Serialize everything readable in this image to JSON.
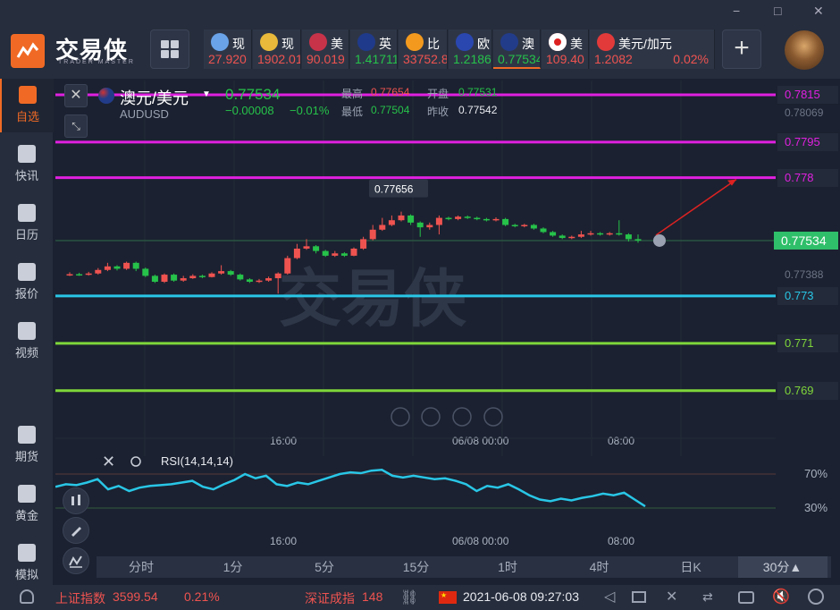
{
  "app": {
    "logo_text": "交易侠",
    "logo_sub": "TRADER MASTER",
    "window_controls": [
      "−",
      "□",
      "✕"
    ]
  },
  "colors": {
    "up": "#ef5350",
    "down": "#26c24a",
    "accent": "#f06a25",
    "magenta": "#e020e0",
    "cyan": "#29c6e6",
    "lime": "#7ed63a",
    "rsi": "#29c6e6"
  },
  "tickers": [
    {
      "name": "现",
      "price": "27.920",
      "icon": "silver-coins-icon",
      "color": "#ef5350"
    },
    {
      "name": "现",
      "price": "1902.01",
      "icon": "gold-coins-icon",
      "color": "#ef5350"
    },
    {
      "name": "美",
      "price": "90.019",
      "icon": "us-flag-icon",
      "color": "#ef5350"
    },
    {
      "name": "英",
      "price": "1.41711",
      "icon": "uk-flag-icon",
      "color": "#26c24a"
    },
    {
      "name": "比",
      "price": "33752.8",
      "icon": "bitcoin-icon",
      "color": "#ef5350"
    },
    {
      "name": "欧",
      "price": "1.21866",
      "icon": "eu-flag-icon",
      "color": "#26c24a"
    },
    {
      "name": "澳",
      "price": "0.77534",
      "icon": "au-flag-icon",
      "color": "#26c24a"
    },
    {
      "name": "美",
      "price": "109.40",
      "icon": "jp-flag-icon",
      "color": "#ef5350"
    },
    {
      "name": "美元/加元",
      "price": "1.2082",
      "change": "0.02%",
      "icon": "ca-flag-icon",
      "color": "#ef5350"
    }
  ],
  "sidebar": {
    "items": [
      {
        "label": "自选",
        "icon": "favorites-icon"
      },
      {
        "label": "快讯",
        "icon": "news-icon"
      },
      {
        "label": "日历",
        "icon": "calendar-icon"
      },
      {
        "label": "报价",
        "icon": "quotes-icon"
      },
      {
        "label": "视频",
        "icon": "video-icon"
      },
      {
        "label": "期货",
        "icon": "futures-icon"
      },
      {
        "label": "黄金",
        "icon": "gold-icon"
      },
      {
        "label": "模拟",
        "icon": "simulate-icon"
      }
    ]
  },
  "symbol": {
    "name": "澳元/美元",
    "code": "AUDUSD",
    "price": "0.77534",
    "change": "−0.00008",
    "change_pct": "−0.01%",
    "high_label": "最高",
    "high": "0.77654",
    "open_label": "开盘",
    "open": "0.77531",
    "low_label": "最低",
    "low": "0.77504",
    "prev_label": "昨收",
    "prev": "0.77542"
  },
  "chart_data": {
    "type": "candlestick",
    "title": "澳元/美元",
    "ylim": [
      0.7685,
      0.7818
    ],
    "hlines": [
      {
        "value": 0.7815,
        "label": "0.7815",
        "color": "#e020e0"
      },
      {
        "value": 0.7795,
        "label": "0.7795",
        "color": "#e020e0"
      },
      {
        "value": 0.778,
        "label": "0.778",
        "color": "#e020e0"
      },
      {
        "value": 0.773,
        "label": "0.773",
        "color": "#29c6e6"
      },
      {
        "value": 0.771,
        "label": "0.771",
        "color": "#7ed63a"
      },
      {
        "value": 0.769,
        "label": "0.769",
        "color": "#7ed63a"
      }
    ],
    "axis_labels": [
      "0.78069",
      "0.77388"
    ],
    "current_price_label": "0.77534",
    "high_marker": "0.77656",
    "x_ticks": [
      "16:00",
      "06/08 00:00",
      "08:00"
    ],
    "candles": [
      [
        0.77388,
        0.77392,
        0.774,
        0.77384
      ],
      [
        0.77392,
        0.7739,
        0.77398,
        0.77385
      ],
      [
        0.7739,
        0.77395,
        0.77402,
        0.77386
      ],
      [
        0.77395,
        0.7741,
        0.77418,
        0.7739
      ],
      [
        0.7741,
        0.77425,
        0.7744,
        0.77405
      ],
      [
        0.77425,
        0.77415,
        0.7743,
        0.77408
      ],
      [
        0.77415,
        0.7744,
        0.77445,
        0.7741
      ],
      [
        0.7744,
        0.77415,
        0.77445,
        0.77405
      ],
      [
        0.77415,
        0.77385,
        0.7742,
        0.7738
      ],
      [
        0.77385,
        0.7736,
        0.7739,
        0.77355
      ],
      [
        0.7736,
        0.7739,
        0.77395,
        0.77355
      ],
      [
        0.7739,
        0.77365,
        0.77395,
        0.7736
      ],
      [
        0.77365,
        0.77375,
        0.77385,
        0.7736
      ],
      [
        0.77375,
        0.77385,
        0.77392,
        0.77372
      ],
      [
        0.77385,
        0.7738,
        0.7739,
        0.77375
      ],
      [
        0.7738,
        0.77395,
        0.774,
        0.77378
      ],
      [
        0.77395,
        0.77405,
        0.7743,
        0.7739
      ],
      [
        0.77405,
        0.7739,
        0.7741,
        0.77385
      ],
      [
        0.7739,
        0.7737,
        0.77395,
        0.77365
      ],
      [
        0.7737,
        0.7736,
        0.77375,
        0.77355
      ],
      [
        0.7736,
        0.77365,
        0.77372,
        0.77355
      ],
      [
        0.77365,
        0.77375,
        0.77382,
        0.7736
      ],
      [
        0.77375,
        0.77395,
        0.774,
        0.7731
      ],
      [
        0.77395,
        0.7746,
        0.7747,
        0.7739
      ],
      [
        0.7746,
        0.775,
        0.7752,
        0.77455
      ],
      [
        0.775,
        0.7751,
        0.7754,
        0.77495
      ],
      [
        0.7751,
        0.7749,
        0.77515,
        0.7748
      ],
      [
        0.7749,
        0.7747,
        0.77495,
        0.77465
      ],
      [
        0.7747,
        0.7748,
        0.7749,
        0.77465
      ],
      [
        0.7748,
        0.7747,
        0.77485,
        0.77465
      ],
      [
        0.7747,
        0.775,
        0.77505,
        0.77468
      ],
      [
        0.775,
        0.7754,
        0.7755,
        0.77495
      ],
      [
        0.7754,
        0.7758,
        0.776,
        0.77535
      ],
      [
        0.7758,
        0.776,
        0.7763,
        0.77575
      ],
      [
        0.776,
        0.7762,
        0.7764,
        0.77595
      ],
      [
        0.7762,
        0.7764,
        0.77656,
        0.77615
      ],
      [
        0.7764,
        0.7761,
        0.77645,
        0.776
      ],
      [
        0.7761,
        0.7759,
        0.77615,
        0.7755
      ],
      [
        0.7759,
        0.776,
        0.7761,
        0.7758
      ],
      [
        0.776,
        0.7763,
        0.7764,
        0.7756
      ],
      [
        0.7763,
        0.77625,
        0.77635,
        0.7762
      ],
      [
        0.77625,
        0.77635,
        0.7764,
        0.7762
      ],
      [
        0.77635,
        0.7763,
        0.7764,
        0.77625
      ],
      [
        0.7763,
        0.77625,
        0.77635,
        0.7762
      ],
      [
        0.77625,
        0.7762,
        0.7763,
        0.77615
      ],
      [
        0.7762,
        0.77625,
        0.77632,
        0.77615
      ],
      [
        0.77625,
        0.776,
        0.7763,
        0.77595
      ],
      [
        0.776,
        0.77595,
        0.77605,
        0.7759
      ],
      [
        0.77595,
        0.776,
        0.77605,
        0.7759
      ],
      [
        0.776,
        0.77585,
        0.77605,
        0.7758
      ],
      [
        0.77585,
        0.7757,
        0.7759,
        0.77565
      ],
      [
        0.7757,
        0.77555,
        0.77575,
        0.7755
      ],
      [
        0.77555,
        0.77545,
        0.7756,
        0.7754
      ],
      [
        0.77545,
        0.7755,
        0.77555,
        0.7754
      ],
      [
        0.7755,
        0.7756,
        0.77575,
        0.77545
      ],
      [
        0.7756,
        0.77565,
        0.77575,
        0.77555
      ],
      [
        0.77565,
        0.7756,
        0.7757,
        0.77555
      ],
      [
        0.7756,
        0.77565,
        0.7757,
        0.77555
      ],
      [
        0.77565,
        0.7756,
        0.7762,
        0.77555
      ],
      [
        0.7756,
        0.7754,
        0.77565,
        0.7753
      ],
      [
        0.7754,
        0.77534,
        0.7756,
        0.77525
      ]
    ]
  },
  "rsi": {
    "label": "RSI(14,14,14)",
    "levels": [
      "70%",
      "30%"
    ],
    "x_ticks": [
      "16:00",
      "06/08 00:00",
      "08:00"
    ],
    "values": [
      55,
      58,
      57,
      60,
      64,
      52,
      56,
      50,
      54,
      56,
      57,
      58,
      60,
      62,
      55,
      52,
      58,
      63,
      70,
      65,
      68,
      58,
      56,
      60,
      58,
      62,
      66,
      70,
      72,
      71,
      74,
      75,
      68,
      66,
      68,
      66,
      64,
      65,
      62,
      58,
      50,
      56,
      54,
      58,
      52,
      45,
      40,
      38,
      41,
      39,
      42,
      44,
      47,
      45,
      48,
      40,
      32
    ]
  },
  "timeframes": {
    "items": [
      "分时",
      "1分",
      "5分",
      "15分",
      "1时",
      "4时",
      "日K",
      "30分▲"
    ],
    "active": 7
  },
  "statusbar": {
    "index1_name": "上证指数",
    "index1_value": "3599.54",
    "index1_change": "0.21%",
    "index2_name": "深证成指",
    "index2_value": "148",
    "datetime": "2021-06-08 09:27:03"
  }
}
